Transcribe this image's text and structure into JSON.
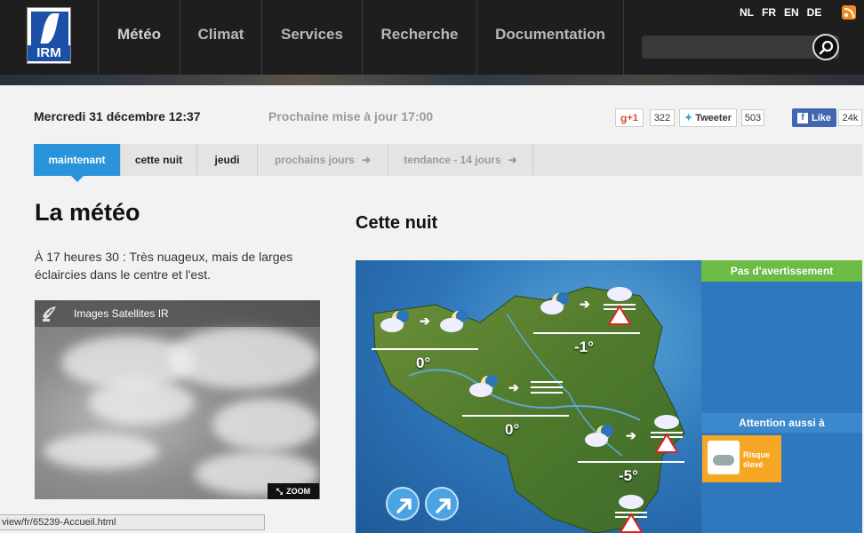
{
  "header": {
    "logo_text": "IRM",
    "nav": [
      "Météo",
      "Climat",
      "Services",
      "Recherche",
      "Documentation"
    ],
    "search_placeholder": "",
    "languages": [
      "NL",
      "FR",
      "EN",
      "DE"
    ]
  },
  "date_row": {
    "date": "Mercredi 31 décembre 12:37",
    "next_update": "Prochaine mise à jour 17:00",
    "gplus_label": "+1",
    "gplus_count": "322",
    "tweet_label": "Tweeter",
    "tweet_count": "503",
    "like_label": "Like",
    "like_count": "24k"
  },
  "tabs": [
    {
      "label": "maintenant",
      "active": true
    },
    {
      "label": "cette nuit",
      "active": false
    },
    {
      "label": "jeudi",
      "active": false
    },
    {
      "label": "prochains jours",
      "active": false,
      "arrow": "➜"
    },
    {
      "label": "tendance - 14 jours",
      "active": false,
      "arrow": "➜"
    }
  ],
  "left": {
    "title": "La météo",
    "summary": "À 17 heures 30 : Très nuageux, mais de larges éclaircies dans le centre et l'est.",
    "satellite_title": "Images Satellites IR",
    "zoom_label": "ZOOM"
  },
  "right": {
    "title": "Cette nuit",
    "temps": [
      "0°",
      "-1°",
      "0°",
      "-5°"
    ],
    "warning": "Pas d'avertissement",
    "attention": "Attention aussi à",
    "risk_line1": "Risque",
    "risk_line2": "élevé"
  },
  "statusbar": {
    "url": "view/fr/65239-Accueil.html"
  },
  "colors": {
    "accent_blue": "#2b93d9",
    "warning_green": "#6bbb44",
    "risk_orange": "#f5a623"
  }
}
